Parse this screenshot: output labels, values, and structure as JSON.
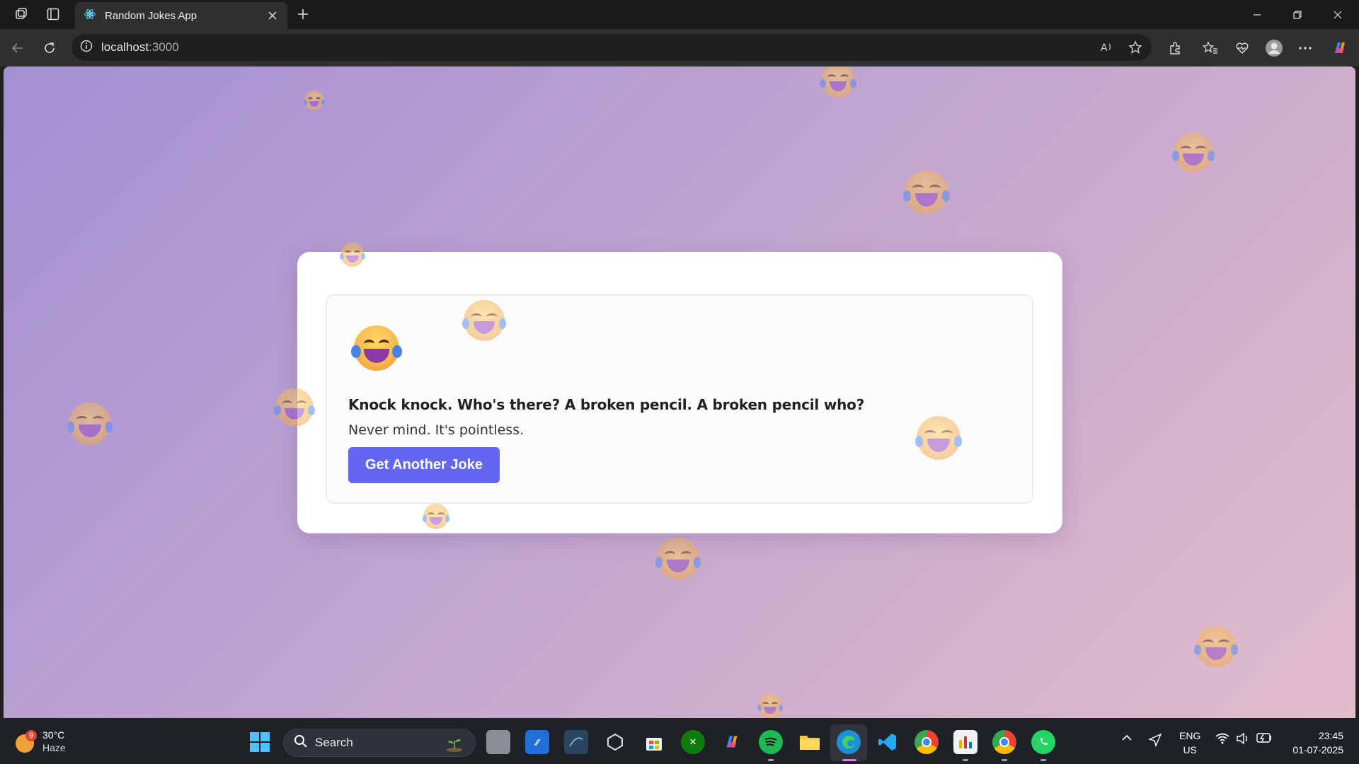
{
  "browser": {
    "tab_title": "Random Jokes App",
    "url_host": "localhost",
    "url_port": ":3000"
  },
  "app": {
    "setup": "Knock knock. Who's there? A broken pencil. A broken pencil who?",
    "punchline": "Never mind. It's pointless.",
    "button_label": "Get Another Joke",
    "button_color": "#6366f1",
    "background_colors": [
      "#a38fd4",
      "#c3a6cf",
      "#e1bccb"
    ]
  },
  "taskbar": {
    "weather_badge": "9",
    "temperature": "30°C",
    "condition": "Haze",
    "search_label": "Search",
    "language": "ENG",
    "region": "US",
    "time": "23:45",
    "date": "01-07-2025"
  }
}
